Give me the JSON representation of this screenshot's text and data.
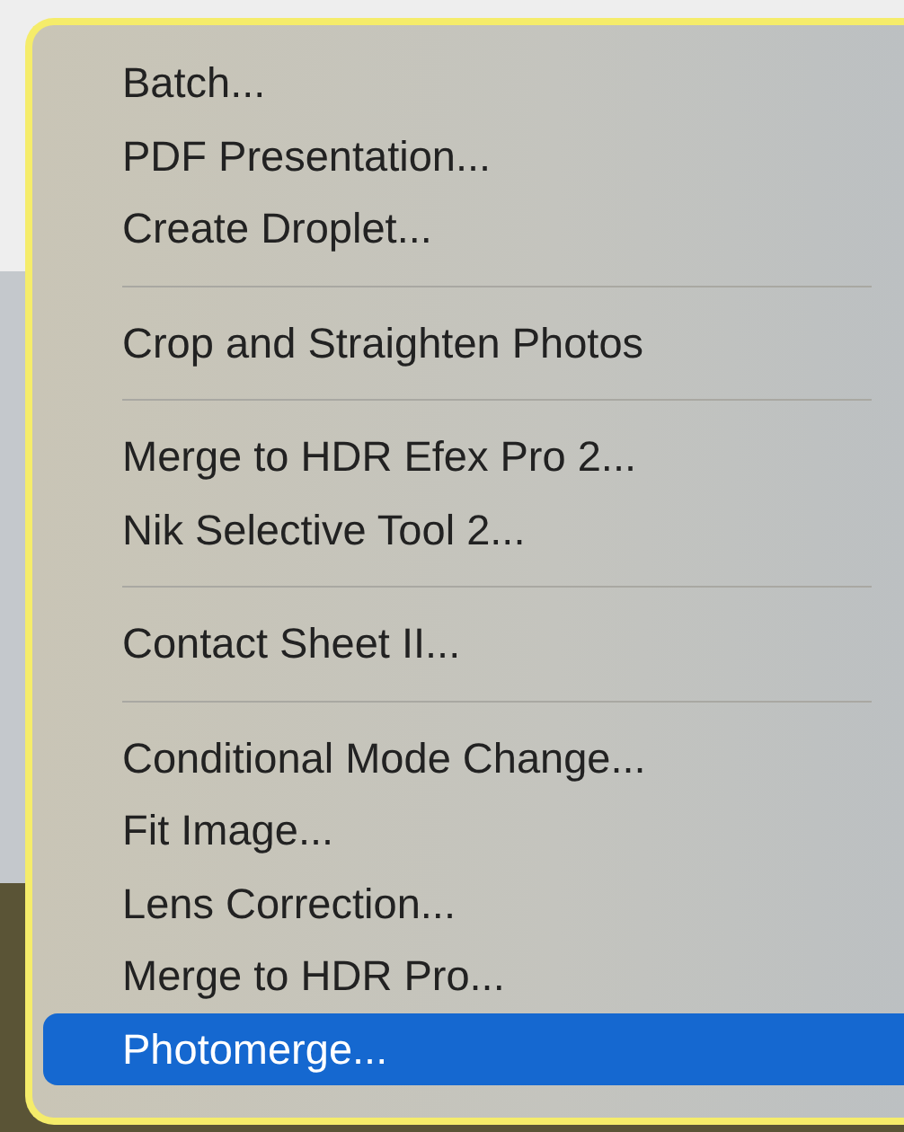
{
  "menu": {
    "groups": [
      [
        {
          "label": "Batch...",
          "selected": false
        },
        {
          "label": "PDF Presentation...",
          "selected": false
        },
        {
          "label": "Create Droplet...",
          "selected": false
        }
      ],
      [
        {
          "label": "Crop and Straighten Photos",
          "selected": false
        }
      ],
      [
        {
          "label": "Merge to HDR Efex Pro 2...",
          "selected": false
        },
        {
          "label": "Nik Selective Tool 2...",
          "selected": false
        }
      ],
      [
        {
          "label": "Contact Sheet II...",
          "selected": false
        }
      ],
      [
        {
          "label": "Conditional Mode Change...",
          "selected": false
        },
        {
          "label": "Fit Image...",
          "selected": false
        },
        {
          "label": "Lens Correction...",
          "selected": false
        },
        {
          "label": "Merge to HDR Pro...",
          "selected": false
        },
        {
          "label": "Photomerge...",
          "selected": true
        }
      ]
    ]
  }
}
